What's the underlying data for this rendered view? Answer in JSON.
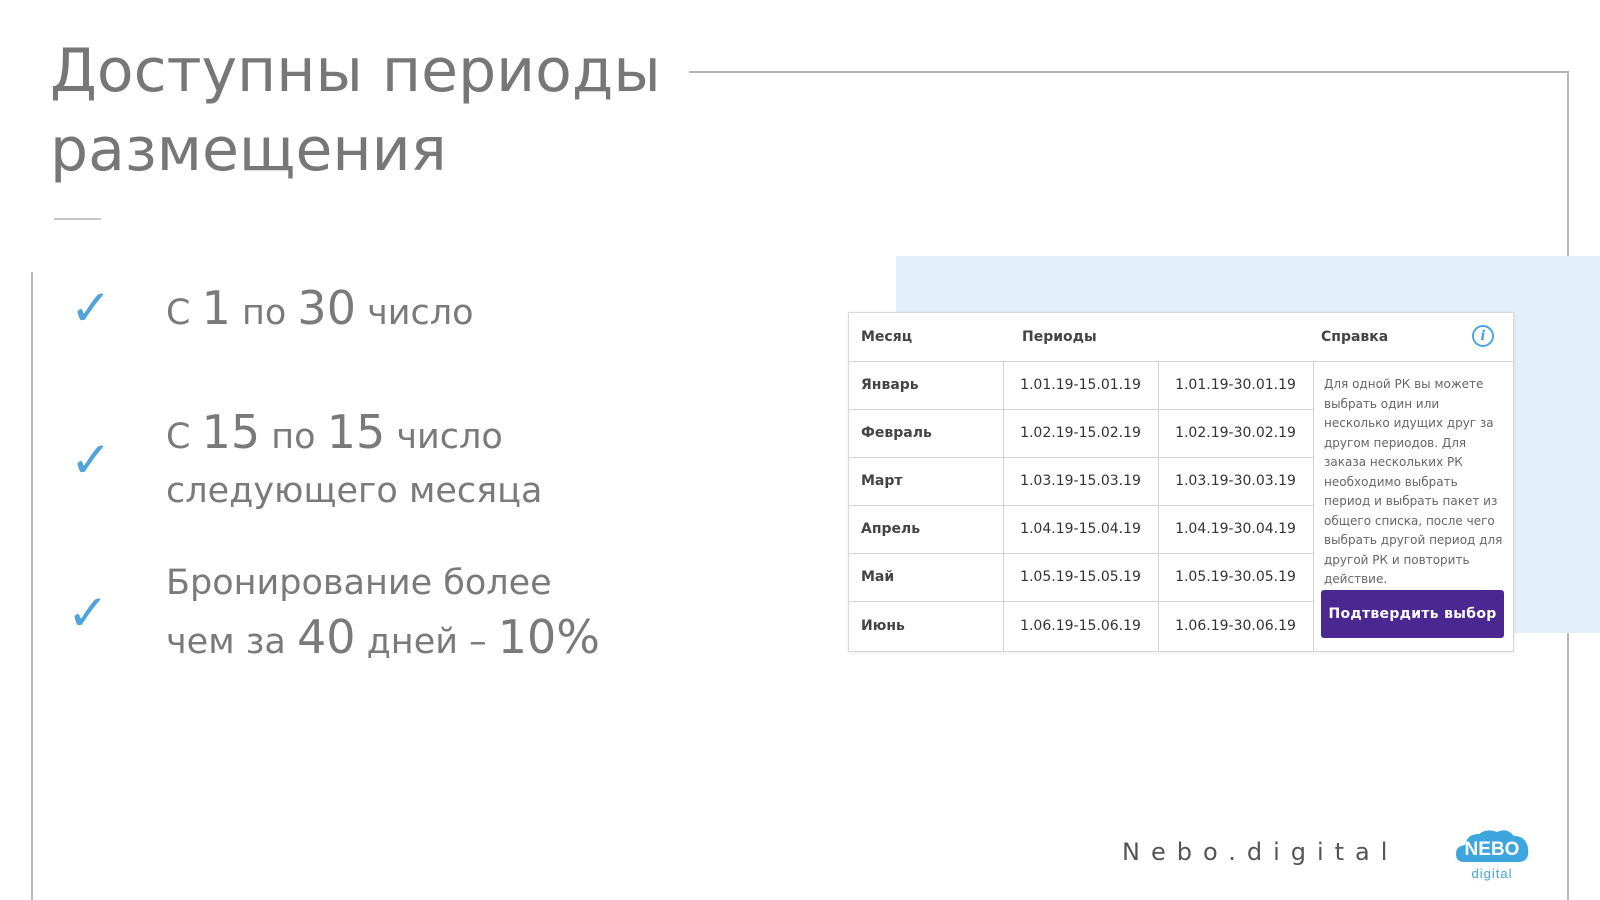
{
  "slide": {
    "title_line1": "Доступны периоды",
    "title_line2": "размещения"
  },
  "features": [
    {
      "pre": "С ",
      "n1": "1",
      "mid": " по ",
      "n2": "30",
      "post": " число"
    },
    {
      "pre": "С ",
      "n1": "15",
      "mid": " по ",
      "n2": "15",
      "post": " число",
      "line2": "следующего месяца"
    },
    {
      "line1": "Бронирование  более",
      "pre": "чем за ",
      "n1": "40",
      "mid": " дней – ",
      "n2": "10%"
    }
  ],
  "table": {
    "headers": {
      "month": "Месяц",
      "periods": "Периоды",
      "help": "Справка"
    },
    "rows": [
      {
        "month": "Январь",
        "p1": "1.01.19-15.01.19",
        "p2": "1.01.19-30.01.19"
      },
      {
        "month": "Февраль",
        "p1": "1.02.19-15.02.19",
        "p2": "1.02.19-30.02.19"
      },
      {
        "month": "Март",
        "p1": "1.03.19-15.03.19",
        "p2": "1.03.19-30.03.19"
      },
      {
        "month": "Апрель",
        "p1": "1.04.19-15.04.19",
        "p2": "1.04.19-30.04.19"
      },
      {
        "month": "Май",
        "p1": "1.05.19-15.05.19",
        "p2": "1.05.19-30.05.19"
      },
      {
        "month": "Июнь",
        "p1": "1.06.19-15.06.19",
        "p2": "1.06.19-30.06.19"
      }
    ],
    "help_text": "Для одной РК вы можете выбрать один или несколько идущих друг за другом периодов. Для заказа нескольких РК необходимо выбрать период и выбрать пакет из общего списка, после чего выбрать другой период для другой РК и повторить действие.",
    "confirm_label": "Подтвердить выбор",
    "info_icon": "info-icon"
  },
  "footer": {
    "brand": "Nebo.digital",
    "logo_top": "NEBO",
    "logo_bottom": "digital"
  },
  "colors": {
    "accent_blue": "#4fa4de",
    "button_purple": "#4b2791",
    "panel_bg": "#e3eff9",
    "text_gray": "#7a7a7a"
  }
}
